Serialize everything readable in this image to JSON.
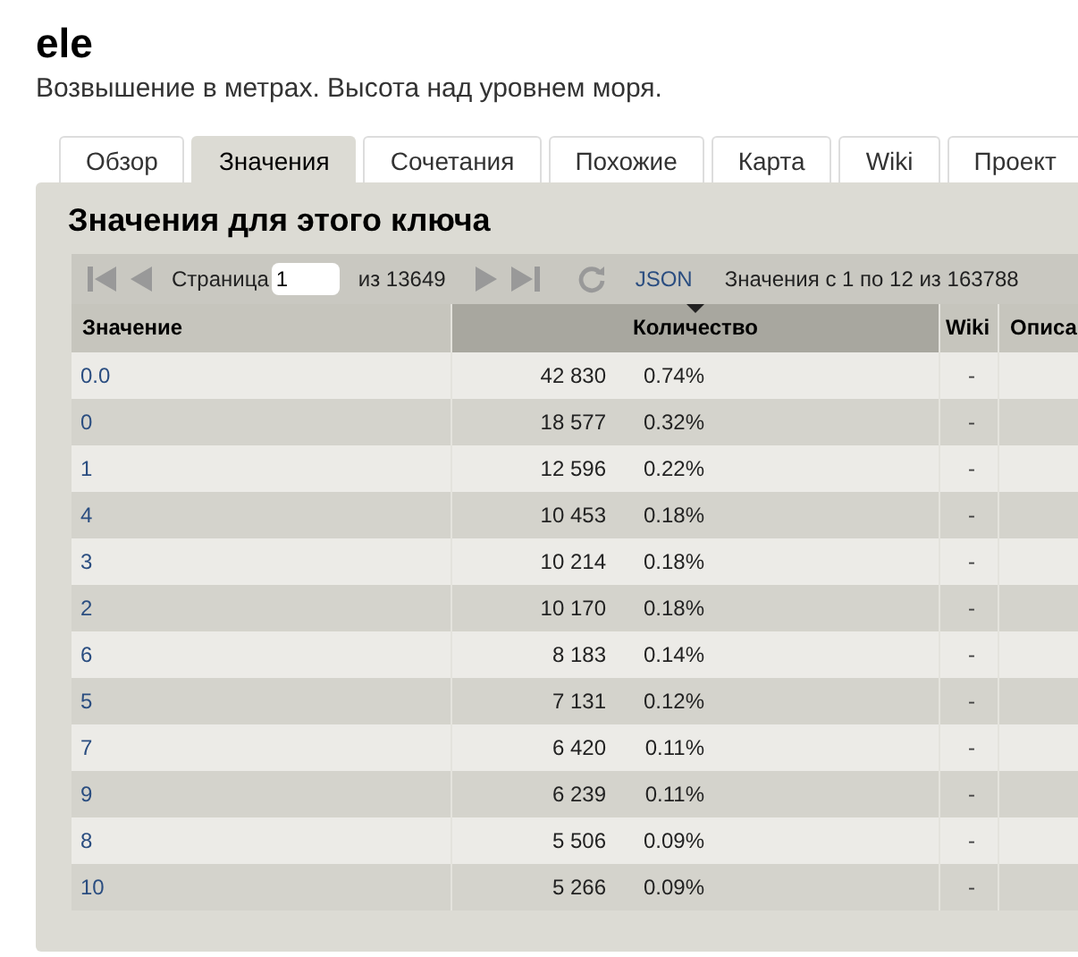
{
  "header": {
    "title": "ele",
    "description": "Возвышение в метрах. Высота над уровнем моря."
  },
  "tabs": [
    {
      "label": "Обзор",
      "selected": false
    },
    {
      "label": "Значения",
      "selected": true
    },
    {
      "label": "Сочетания",
      "selected": false
    },
    {
      "label": "Похожие",
      "selected": false
    },
    {
      "label": "Карта",
      "selected": false
    },
    {
      "label": "Wiki",
      "selected": false
    },
    {
      "label": "Проект",
      "selected": false
    }
  ],
  "panel": {
    "title": "Значения для этого ключа",
    "pager": {
      "page_label": "Страница",
      "page_value": "1",
      "of_label": "из 13649",
      "json_link": "JSON",
      "range_text": "Значения с 1 по 12 из 163788"
    },
    "table": {
      "columns": [
        {
          "label": "Значение",
          "sorted": false
        },
        {
          "label": "Количество",
          "sorted": true
        },
        {
          "label": "Wiki",
          "sorted": false
        },
        {
          "label": "Описа",
          "sorted": false
        }
      ],
      "rows": [
        {
          "value": "0.0",
          "count": "42 830",
          "percent": "0.74%",
          "wiki": "-"
        },
        {
          "value": "0",
          "count": "18 577",
          "percent": "0.32%",
          "wiki": "-"
        },
        {
          "value": "1",
          "count": "12 596",
          "percent": "0.22%",
          "wiki": "-"
        },
        {
          "value": "4",
          "count": "10 453",
          "percent": "0.18%",
          "wiki": "-"
        },
        {
          "value": "3",
          "count": "10 214",
          "percent": "0.18%",
          "wiki": "-"
        },
        {
          "value": "2",
          "count": "10 170",
          "percent": "0.18%",
          "wiki": "-"
        },
        {
          "value": "6",
          "count": "8 183",
          "percent": "0.14%",
          "wiki": "-"
        },
        {
          "value": "5",
          "count": "7 131",
          "percent": "0.12%",
          "wiki": "-"
        },
        {
          "value": "7",
          "count": "6 420",
          "percent": "0.11%",
          "wiki": "-"
        },
        {
          "value": "9",
          "count": "6 239",
          "percent": "0.11%",
          "wiki": "-"
        },
        {
          "value": "8",
          "count": "5 506",
          "percent": "0.09%",
          "wiki": "-"
        },
        {
          "value": "10",
          "count": "5 266",
          "percent": "0.09%",
          "wiki": "-"
        }
      ]
    }
  }
}
